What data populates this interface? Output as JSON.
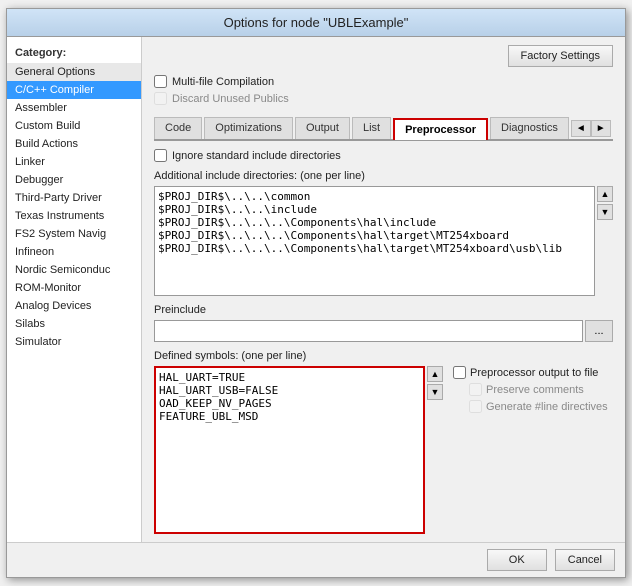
{
  "dialog": {
    "title": "Options for node \"UBLExample\"",
    "factory_settings_btn": "Factory Settings"
  },
  "sidebar": {
    "category_label": "Category:",
    "items": [
      {
        "id": "general-options",
        "label": "General Options",
        "selected": false,
        "style": "general"
      },
      {
        "id": "cpp-compiler",
        "label": "C/C++ Compiler",
        "selected": true
      },
      {
        "id": "assembler",
        "label": "Assembler",
        "selected": false
      },
      {
        "id": "custom-build",
        "label": "Custom Build",
        "selected": false
      },
      {
        "id": "build-actions",
        "label": "Build Actions",
        "selected": false
      },
      {
        "id": "linker",
        "label": "Linker",
        "selected": false
      },
      {
        "id": "debugger",
        "label": "Debugger",
        "selected": false
      },
      {
        "id": "third-party",
        "label": "Third-Party Driver",
        "selected": false
      },
      {
        "id": "texas",
        "label": "Texas Instruments",
        "selected": false
      },
      {
        "id": "fs2",
        "label": "FS2 System Navig",
        "selected": false
      },
      {
        "id": "infineon",
        "label": "Infineon",
        "selected": false
      },
      {
        "id": "nordic",
        "label": "Nordic Semiconduc",
        "selected": false
      },
      {
        "id": "rom-monitor",
        "label": "ROM-Monitor",
        "selected": false
      },
      {
        "id": "analog-devices",
        "label": "Analog Devices",
        "selected": false
      },
      {
        "id": "silabs",
        "label": "Silabs",
        "selected": false
      },
      {
        "id": "simulator",
        "label": "Simulator",
        "selected": false
      }
    ]
  },
  "main": {
    "multifile_label": "Multi-file Compilation",
    "discard_label": "Discard Unused Publics",
    "tabs": [
      {
        "id": "code",
        "label": "Code"
      },
      {
        "id": "optimizations",
        "label": "Optimizations"
      },
      {
        "id": "output",
        "label": "Output"
      },
      {
        "id": "list",
        "label": "List"
      },
      {
        "id": "preprocessor",
        "label": "Preprocessor",
        "active": true
      },
      {
        "id": "diagnostics",
        "label": "Diagnostics"
      }
    ],
    "ignore_label": "Ignore standard include directories",
    "include_dirs_label": "Additional include directories: (one per line)",
    "include_dirs_lines": [
      "$PROJ_DIR$\\..\\..\\common",
      "$PROJ_DIR$\\..\\..\\include",
      "$PROJ_DIR$\\..\\..\\..\\Components\\hal\\include",
      "$PROJ_DIR$\\..\\..\\..\\Components\\hal\\target\\MT254xboard",
      "$PROJ_DIR$\\..\\..\\..\\Components\\hal\\target\\MT254xboard\\usb\\lib"
    ],
    "preinclude_label": "Preinclude",
    "preinclude_value": "",
    "browse_btn": "...",
    "defined_symbols_label": "Defined symbols: (one per line)",
    "defined_symbols_lines": [
      "HAL_UART=TRUE",
      "HAL_UART_USB=FALSE",
      "OAD_KEEP_NV_PAGES",
      "FEATURE_UBL_MSD"
    ],
    "preprocessor_output_label": "Preprocessor output to file",
    "preserve_comments_label": "Preserve comments",
    "generate_directives_label": "Generate #line directives"
  },
  "footer": {
    "ok_label": "OK",
    "cancel_label": "Cancel"
  }
}
